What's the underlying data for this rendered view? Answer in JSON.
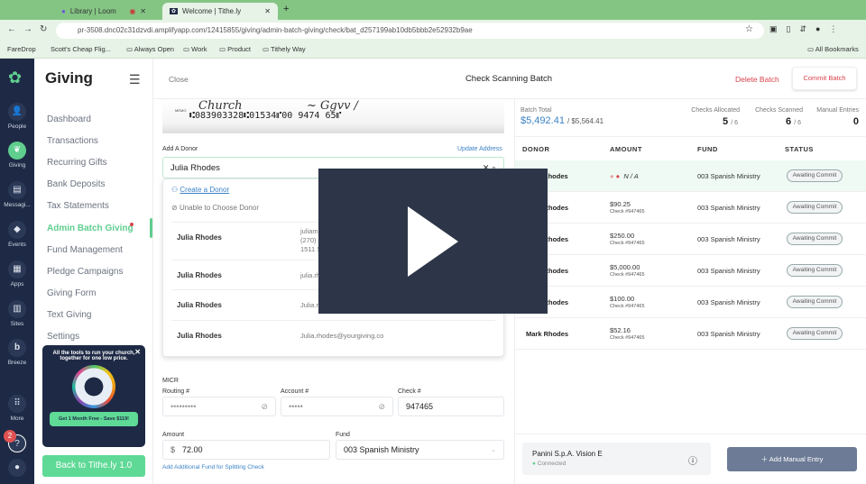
{
  "browser": {
    "tabs": [
      {
        "title": "Library | Loom"
      },
      {
        "title": "Welcome | Tithe.ly"
      }
    ],
    "url": "pr-3508.dnc02c31dzvdi.amplifyapp.com/12415855/giving/admin-batch-giving/check/bat_d257199ab10db5bbb2e52932b9ae",
    "bookmarks": [
      "FareDrop",
      "Scott's Cheap Flig...",
      "Always Open",
      "Work",
      "Product",
      "Tithely Way"
    ],
    "all_bookmarks": "All Bookmarks"
  },
  "rail": {
    "items": [
      {
        "label": "People"
      },
      {
        "label": "Giving"
      },
      {
        "label": "Messagi..."
      },
      {
        "label": "Events"
      },
      {
        "label": "Apps"
      },
      {
        "label": "Sites"
      },
      {
        "label": "Breeze"
      },
      {
        "label": "More"
      }
    ],
    "help_badge": "2"
  },
  "sidebar": {
    "title": "Giving",
    "items": [
      "Dashboard",
      "Transactions",
      "Recurring Gifts",
      "Bank Deposits",
      "Tax Statements",
      "Admin Batch Giving",
      "Fund Management",
      "Pledge Campaigns",
      "Giving Form",
      "Text Giving",
      "Settings"
    ],
    "promo": {
      "text": "All the tools to run your church, together for one low price.",
      "cta": "Get 1 Month Free - Save $119!"
    },
    "back": "Back to Tithe.ly 1.0"
  },
  "header": {
    "close": "Close",
    "title": "Check Scanning Batch",
    "delete": "Delete Batch",
    "commit": "Commit Batch"
  },
  "check": {
    "micr_line": "⑆083903328⑆01534⑈00 9474 65⑈",
    "memo": "MEMO"
  },
  "donor": {
    "label": "Add A Donor",
    "update_address": "Update Address",
    "value": "Julia Rhodes",
    "create": "Create a Donor",
    "unable": "Unable to Choose Donor",
    "results": [
      {
        "name": "Julia Rhodes",
        "lines": [
          "juliam...@gmail.com",
          "(270) 363-5770",
          "1511 Sycamore Street Murray, KY"
        ]
      },
      {
        "name": "Julia Rhodes",
        "lines": [
          "julia.rhodes@tithe.ly"
        ]
      },
      {
        "name": "Julia Rhodes",
        "lines": [
          "Julia.rhodes@yourgiving.co"
        ]
      },
      {
        "name": "Julia Rhodes",
        "lines": [
          "Julia.rhodes@yourgiving.co"
        ]
      }
    ]
  },
  "micr": {
    "label": "MICR",
    "routing_label": "Routing #",
    "routing": "•••••••••",
    "account_label": "Account #",
    "account": "•••••",
    "check_label": "Check #",
    "check": "947465"
  },
  "amount": {
    "label": "Amount",
    "currency": "$",
    "value": "72.00",
    "fund_label": "Fund",
    "fund": "003 Spanish Ministry",
    "split": "Add Additional Fund for Splitting Check"
  },
  "stats": {
    "batch_label": "Batch Total",
    "batch": "$5,492.41",
    "batch_of": "/ $5,564.41",
    "alloc_label": "Checks Allocated",
    "alloc": "5",
    "alloc_of": "/ 6",
    "scan_label": "Checks Scanned",
    "scan": "6",
    "scan_of": "/ 6",
    "manual_label": "Manual Entries",
    "manual": "0"
  },
  "table": {
    "headers": [
      "DONOR",
      "AMOUNT",
      "FUND",
      "STATUS"
    ],
    "rows": [
      {
        "donor": "Julia Rhodes",
        "amount": "N / A",
        "check": "",
        "fund": "003 Spanish Ministry",
        "status": "Awaiting Commit"
      },
      {
        "donor": "Mark Rhodes",
        "amount": "$90.25",
        "check": "Check #947465",
        "fund": "003 Spanish Ministry",
        "status": "Awaiting Commit"
      },
      {
        "donor": "Mark Rhodes",
        "amount": "$250.00",
        "check": "Check #947465",
        "fund": "003 Spanish Ministry",
        "status": "Awaiting Commit"
      },
      {
        "donor": "Mark Rhodes",
        "amount": "$5,000.00",
        "check": "Check #947465",
        "fund": "003 Spanish Ministry",
        "status": "Awaiting Commit"
      },
      {
        "donor": "Mark Rhodes",
        "amount": "$100.00",
        "check": "Check #947465",
        "fund": "003 Spanish Ministry",
        "status": "Awaiting Commit"
      },
      {
        "donor": "Mark Rhodes",
        "amount": "$52.16",
        "check": "Check #947465",
        "fund": "003 Spanish Ministry",
        "status": "Awaiting Commit"
      }
    ]
  },
  "scanner": {
    "name": "Panini S.p.A. Vision E",
    "status": "Connected"
  },
  "manual_entry": "Add Manual Entry",
  "colors": {
    "accent": "#5fce8f",
    "navy": "#1e2a45",
    "link": "#3b82c4",
    "danger": "#d9434b"
  }
}
